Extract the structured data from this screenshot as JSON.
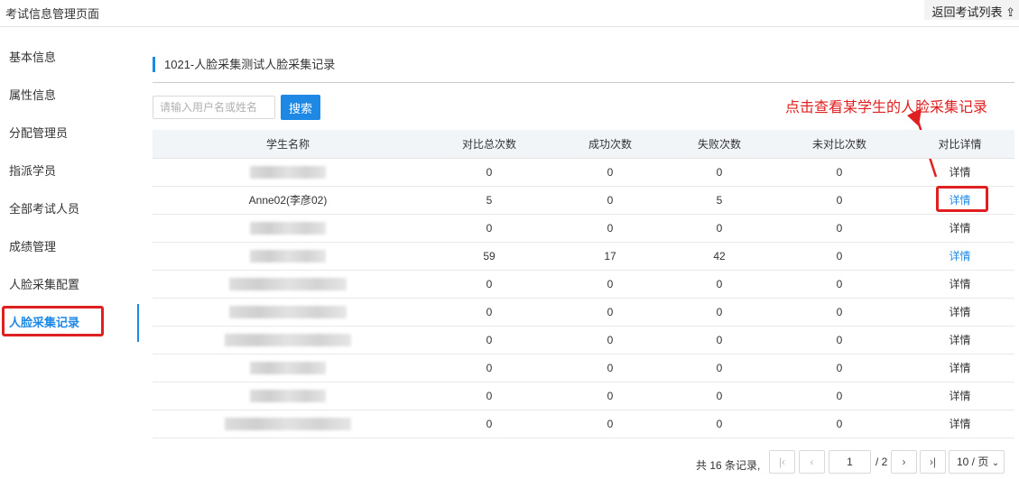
{
  "header": {
    "title": "考试信息管理页面",
    "back_label": "返回考试列表 ⇪"
  },
  "sidebar": {
    "items": [
      {
        "label": "基本信息"
      },
      {
        "label": "属性信息"
      },
      {
        "label": "分配管理员"
      },
      {
        "label": "指派学员"
      },
      {
        "label": "全部考试人员"
      },
      {
        "label": "成绩管理"
      },
      {
        "label": "人脸采集配置"
      },
      {
        "label": "人脸采集记录"
      }
    ],
    "active_index": 7
  },
  "main": {
    "section_title": "1021-人脸采集测试人脸采集记录",
    "search": {
      "placeholder": "请输入用户名或姓名",
      "value": "",
      "button_label": "搜索"
    },
    "annotation": "点击查看某学生的人脸采集记录",
    "table": {
      "columns": [
        "学生名称",
        "对比总次数",
        "成功次数",
        "失败次数",
        "未对比次数",
        "对比详情"
      ],
      "rows": [
        {
          "name": "",
          "total": "0",
          "success": "0",
          "fail": "0",
          "uncompared": "0",
          "detail": "详情",
          "detail_link": false
        },
        {
          "name": "Anne02(李彦02)",
          "total": "5",
          "success": "0",
          "fail": "5",
          "uncompared": "0",
          "detail": "详情",
          "detail_link": true
        },
        {
          "name": "",
          "total": "0",
          "success": "0",
          "fail": "0",
          "uncompared": "0",
          "detail": "详情",
          "detail_link": false
        },
        {
          "name": "",
          "total": "59",
          "success": "17",
          "fail": "42",
          "uncompared": "0",
          "detail": "详情",
          "detail_link": true
        },
        {
          "name": "",
          "total": "0",
          "success": "0",
          "fail": "0",
          "uncompared": "0",
          "detail": "详情",
          "detail_link": false
        },
        {
          "name": "",
          "total": "0",
          "success": "0",
          "fail": "0",
          "uncompared": "0",
          "detail": "详情",
          "detail_link": false
        },
        {
          "name": "",
          "total": "0",
          "success": "0",
          "fail": "0",
          "uncompared": "0",
          "detail": "详情",
          "detail_link": false
        },
        {
          "name": "",
          "total": "0",
          "success": "0",
          "fail": "0",
          "uncompared": "0",
          "detail": "详情",
          "detail_link": false
        },
        {
          "name": "",
          "total": "0",
          "success": "0",
          "fail": "0",
          "uncompared": "0",
          "detail": "详情",
          "detail_link": false
        },
        {
          "name": "",
          "total": "0",
          "success": "0",
          "fail": "0",
          "uncompared": "0",
          "detail": "详情",
          "detail_link": false
        }
      ]
    },
    "pager": {
      "total_text": "共 16 条记录,",
      "current_page": "1",
      "pages_text": "/ 2",
      "page_size": "10 / 页"
    }
  },
  "colors": {
    "accent": "#1e88e5",
    "highlight": "#e02020"
  },
  "icons": {
    "first": "first-page-icon",
    "prev": "chevron-left-icon",
    "next": "chevron-right-icon",
    "last": "last-page-icon",
    "dropdown": "chevron-down-icon"
  }
}
